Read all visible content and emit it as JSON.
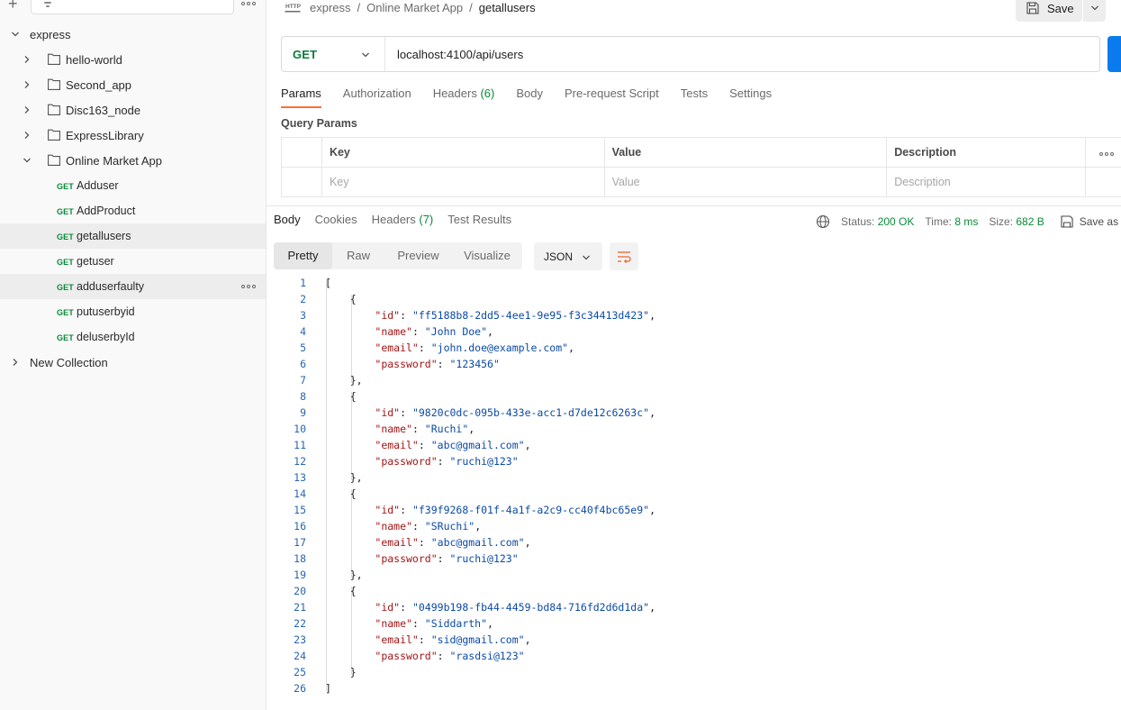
{
  "sidebar": {
    "collection": "express",
    "folders": [
      {
        "label": "hello-world",
        "expanded": false
      },
      {
        "label": "Second_app",
        "expanded": false
      },
      {
        "label": "Disc163_node",
        "expanded": false
      },
      {
        "label": "ExpressLibrary",
        "expanded": false
      },
      {
        "label": "Online Market App",
        "expanded": true
      }
    ],
    "requests": [
      {
        "method": "GET",
        "label": "Adduser"
      },
      {
        "method": "GET",
        "label": "AddProduct"
      },
      {
        "method": "GET",
        "label": "getallusers",
        "selected": true
      },
      {
        "method": "GET",
        "label": "getuser"
      },
      {
        "method": "GET",
        "label": "adduserfaulty",
        "hovered": true
      },
      {
        "method": "GET",
        "label": "putuserbyid"
      },
      {
        "method": "GET",
        "label": "deluserbyId"
      }
    ],
    "other_collection": "New Collection"
  },
  "breadcrumb": [
    "express",
    "Online Market App",
    "getallusers"
  ],
  "toolbar": {
    "save_label": "Save"
  },
  "request": {
    "method": "GET",
    "url": "localhost:4100/api/users",
    "tabs": [
      {
        "label": "Params",
        "active": true
      },
      {
        "label": "Authorization"
      },
      {
        "label": "Headers",
        "count": "(6)"
      },
      {
        "label": "Body"
      },
      {
        "label": "Pre-request Script"
      },
      {
        "label": "Tests"
      },
      {
        "label": "Settings"
      }
    ],
    "query_params_label": "Query Params",
    "table": {
      "headers": [
        "Key",
        "Value",
        "Description"
      ],
      "placeholders": [
        "Key",
        "Value",
        "Description"
      ]
    }
  },
  "response": {
    "tabs": [
      {
        "label": "Body",
        "active": true
      },
      {
        "label": "Cookies"
      },
      {
        "label": "Headers",
        "count": "(7)"
      },
      {
        "label": "Test Results"
      }
    ],
    "status_label": "Status:",
    "status_value": "200 OK",
    "time_label": "Time:",
    "time_value": "8 ms",
    "size_label": "Size:",
    "size_value": "682 B",
    "save_as_label": "Save as",
    "view_modes": [
      "Pretty",
      "Raw",
      "Preview",
      "Visualize"
    ],
    "active_view": "Pretty",
    "format": "JSON",
    "users": [
      {
        "id": "ff5188b8-2dd5-4ee1-9e95-f3c34413d423",
        "name": "John Doe",
        "email": "john.doe@example.com",
        "password": "123456"
      },
      {
        "id": "9820c0dc-095b-433e-acc1-d7de12c6263c",
        "name": "Ruchi",
        "email": "abc@gmail.com",
        "password": "ruchi@123"
      },
      {
        "id": "f39f9268-f01f-4a1f-a2c9-cc40f4bc65e9",
        "name": "SRuchi",
        "email": "abc@gmail.com",
        "password": "ruchi@123"
      },
      {
        "id": "0499b198-fb44-4459-bd84-716fd2d6d1da",
        "name": "Siddarth",
        "email": "sid@gmail.com",
        "password": "rasdsi@123"
      }
    ]
  },
  "colors": {
    "accent": "#ff6c37",
    "get_method": "#0a8a3a",
    "send": "#097bed",
    "status_ok": "#0a8a3a"
  }
}
